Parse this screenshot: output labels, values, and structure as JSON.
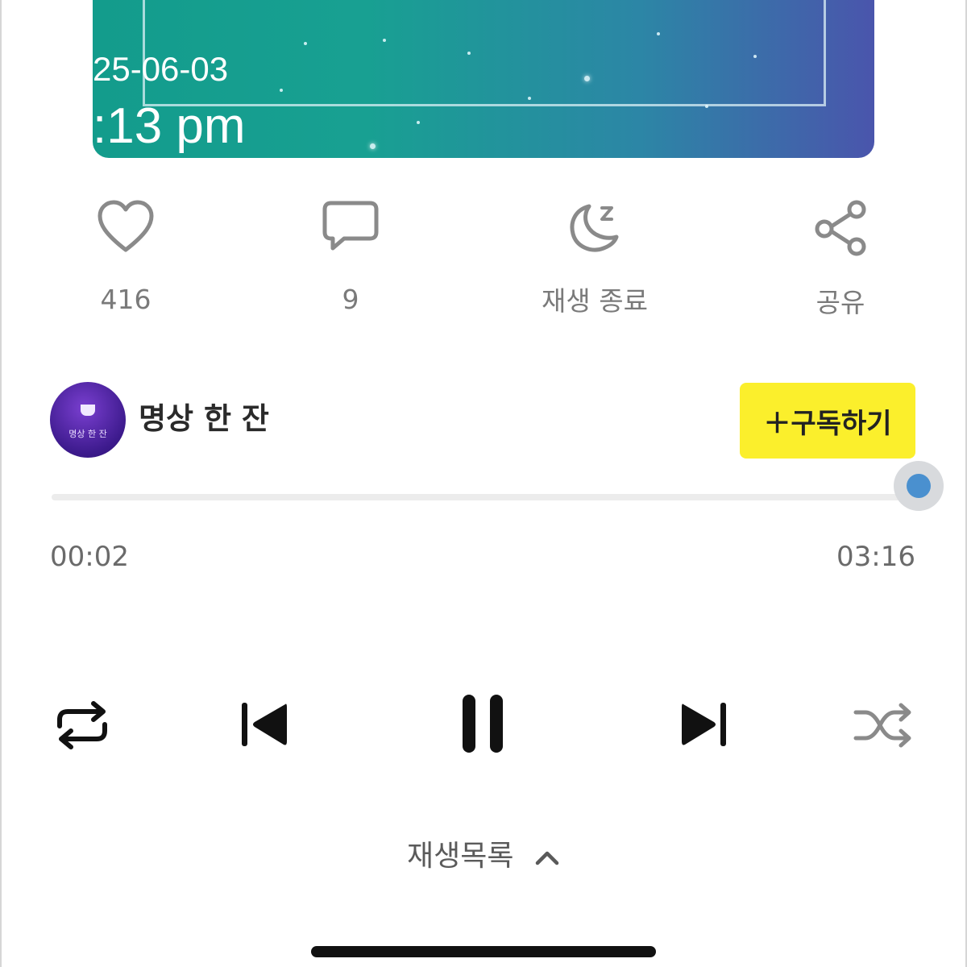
{
  "overlay": {
    "date": "25-06-03",
    "time": ":13 pm"
  },
  "actions": [
    {
      "name": "like",
      "icon": "heart-icon",
      "label": "416"
    },
    {
      "name": "comment",
      "icon": "comment-icon",
      "label": "9"
    },
    {
      "name": "sleep-timer",
      "icon": "moon-sleep-icon",
      "label": "재생 종료"
    },
    {
      "name": "share",
      "icon": "share-icon",
      "label": "공유"
    }
  ],
  "channel": {
    "name": "명상 한 잔",
    "avatar_text": "명상 한 잔",
    "subscribe_label": "＋구독하기"
  },
  "player": {
    "elapsed": "00:02",
    "total": "03:16",
    "progress_fraction": 0.99,
    "controls": [
      "repeat-icon",
      "previous-icon",
      "pause-icon",
      "next-icon",
      "shuffle-icon"
    ]
  },
  "playlist": {
    "label": "재생목록"
  },
  "colors": {
    "subscribe_bg": "#fbef2c",
    "progress_knob": "#4a90cf",
    "artwork_left": "#139c8c",
    "artwork_right": "#4a55ac"
  }
}
